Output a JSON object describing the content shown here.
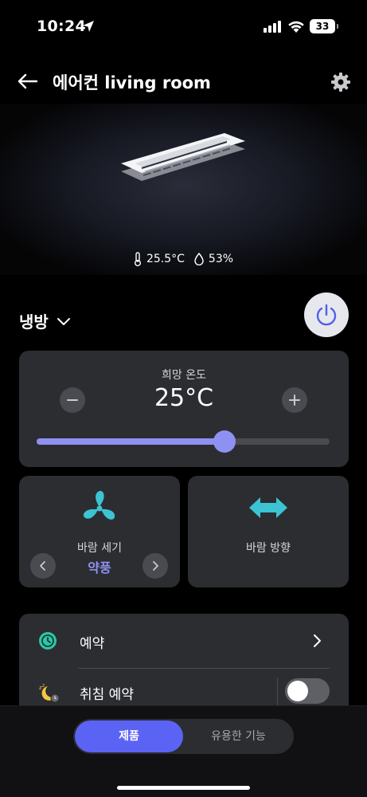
{
  "status_bar": {
    "time": "10:24",
    "battery": "33"
  },
  "header": {
    "title": "에어컨 living room"
  },
  "hero": {
    "temperature": "25.5°C",
    "humidity": "53%"
  },
  "mode": {
    "label": "냉방"
  },
  "temperature_card": {
    "label": "희망 온도",
    "value": "25°C",
    "slider_level": 0.64
  },
  "fan_card": {
    "label": "바람 세기",
    "value": "약풍"
  },
  "direction_card": {
    "label": "바람 방향"
  },
  "list": {
    "reservation_label": "예약",
    "sleep_label": "취침 예약",
    "sleep_enabled": false
  },
  "bottom_nav": {
    "tab_product": "제품",
    "tab_features": "유용한 기능"
  },
  "colors": {
    "accent": "#8f91f2",
    "active_tab": "#5b63f5",
    "icon_teal": "#3cc3d4",
    "card": "#2c2d31"
  }
}
